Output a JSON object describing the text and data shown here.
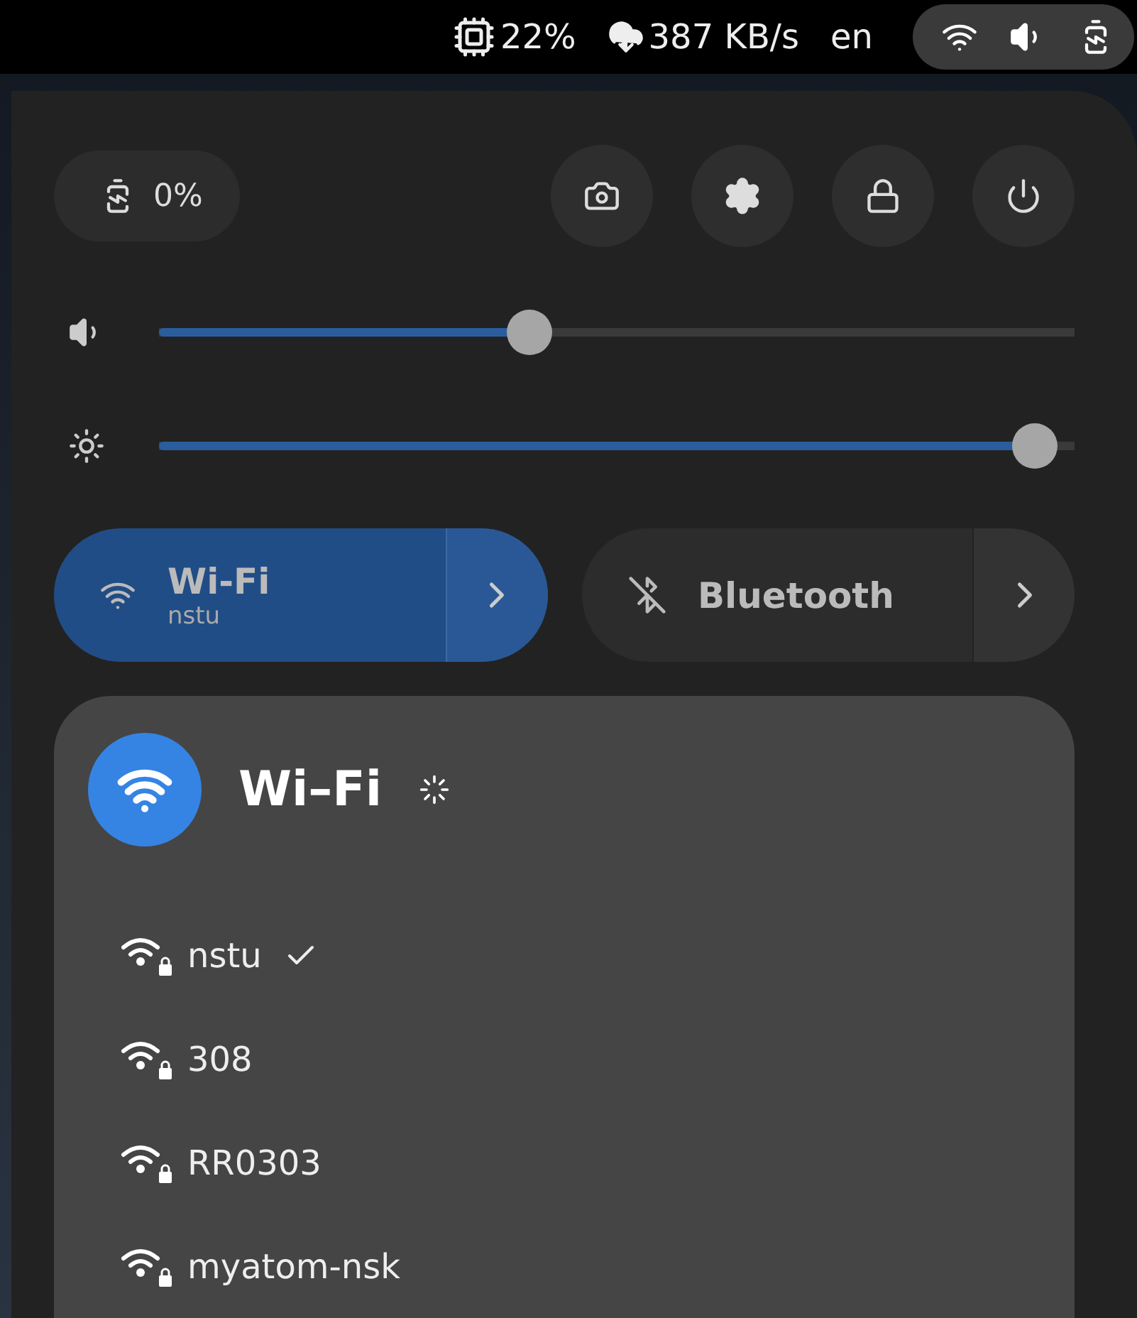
{
  "top_bar": {
    "cpu": "22%",
    "network_speed": "387 KB/s",
    "keyboard_layout": "en"
  },
  "battery": {
    "label": "0%"
  },
  "sliders": [
    {
      "kind": "volume",
      "level": 0.4
    },
    {
      "kind": "brightness",
      "level": 0.98
    }
  ],
  "toggles": [
    {
      "kind": "wifi",
      "label": "Wi-Fi",
      "subtitle": "nstu",
      "on": true
    },
    {
      "kind": "bluetooth",
      "label": "Bluetooth",
      "on": false
    }
  ],
  "wifi_menu": {
    "title": "Wi–Fi",
    "scanning": true,
    "networks": [
      {
        "name": "nstu",
        "selected": true
      },
      {
        "name": "308",
        "selected": false
      },
      {
        "name": "RR0303",
        "selected": false
      },
      {
        "name": "myatom-nsk",
        "selected": false
      }
    ]
  }
}
